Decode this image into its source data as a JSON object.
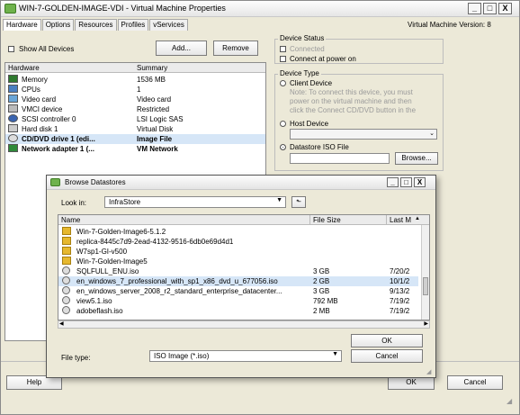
{
  "window": {
    "title": "WIN-7-GOLDEN-IMAGE-VDI - Virtual Machine Properties",
    "tabs": [
      "Hardware",
      "Options",
      "Resources",
      "Profiles",
      "vServices"
    ],
    "vm_version": "Virtual Machine Version: 8",
    "minimize": "_",
    "maximize": "□",
    "close": "X"
  },
  "hardware": {
    "show_all_devices": "Show All Devices",
    "add_button": "Add...",
    "remove_button": "Remove",
    "columns": [
      "Hardware",
      "Summary"
    ],
    "rows": [
      {
        "name": "Memory",
        "summary": "1536 MB"
      },
      {
        "name": "CPUs",
        "summary": "1"
      },
      {
        "name": "Video card",
        "summary": "Video card"
      },
      {
        "name": "VMCI device",
        "summary": "Restricted"
      },
      {
        "name": "SCSI controller 0",
        "summary": "LSI Logic SAS"
      },
      {
        "name": "Hard disk 1",
        "summary": "Virtual Disk"
      },
      {
        "name": "CD/DVD drive 1 (edi...",
        "summary": "Image File"
      },
      {
        "name": "Network adapter 1 (...",
        "summary": "VM Network"
      }
    ]
  },
  "device_status": {
    "title": "Device Status",
    "connected": "Connected",
    "connect_at_power_on": "Connect at power on"
  },
  "device_type": {
    "title": "Device Type",
    "client_device": "Client Device",
    "note": [
      "Note: To connect this device, you must",
      "power on the virtual machine and then",
      "click the Connect CD/DVD button in the"
    ],
    "host_device": "Host Device",
    "datastore_iso": "Datastore ISO File",
    "browse_button": "Browse..."
  },
  "browse": {
    "title": "Browse Datastores",
    "look_in_label": "Look in:",
    "look_in_value": "InfraStore",
    "columns": [
      "Name",
      "File Size",
      "Last M"
    ],
    "files": [
      {
        "name": "Win-7-Golden-Image6-5.1.2",
        "size": "",
        "modified": "",
        "kind": "folder"
      },
      {
        "name": "replica-8445c7d9-2ead-4132-9516-6db0e69d4d1",
        "size": "",
        "modified": "",
        "kind": "folder"
      },
      {
        "name": "W7sp1-GI-v500",
        "size": "",
        "modified": "",
        "kind": "folder"
      },
      {
        "name": "Win-7-Golden-Image5",
        "size": "",
        "modified": "",
        "kind": "folder"
      },
      {
        "name": "SQLFULL_ENU.iso",
        "size": "3 GB",
        "modified": "7/20/2",
        "kind": "iso"
      },
      {
        "name": "en_windows_7_professional_with_sp1_x86_dvd_u_677056.iso",
        "size": "2 GB",
        "modified": "10/1/2",
        "kind": "iso"
      },
      {
        "name": "en_windows_server_2008_r2_standard_enterprise_datacenter...",
        "size": "3 GB",
        "modified": "9/13/2",
        "kind": "iso"
      },
      {
        "name": "view5.1.iso",
        "size": "792 MB",
        "modified": "7/19/2",
        "kind": "iso"
      },
      {
        "name": "adobeflash.iso",
        "size": "2 MB",
        "modified": "7/19/2",
        "kind": "iso"
      }
    ],
    "file_type_label": "File type:",
    "file_type_value": "ISO Image (*.iso)",
    "ok_button": "OK",
    "cancel_button": "Cancel"
  },
  "footer": {
    "help_button": "Help",
    "ok_button": "OK",
    "cancel_button": "Cancel"
  }
}
